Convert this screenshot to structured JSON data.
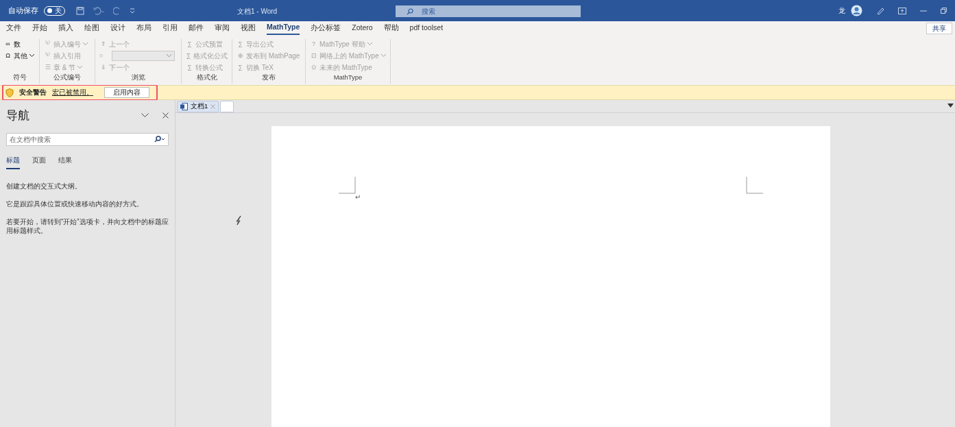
{
  "title_bar": {
    "autosave_label": "自动保存",
    "autosave": {
      "label": "关",
      "on": false
    },
    "title": "文档1  -  Word",
    "search_placeholder": "搜索",
    "user": "龙"
  },
  "ribbon_tabs": [
    {
      "label": "文件",
      "selected": false
    },
    {
      "label": "开始",
      "selected": false
    },
    {
      "label": "插入",
      "selected": false
    },
    {
      "label": "绘图",
      "selected": false
    },
    {
      "label": "设计",
      "selected": false
    },
    {
      "label": "布局",
      "selected": false
    },
    {
      "label": "引用",
      "selected": false
    },
    {
      "label": "邮件",
      "selected": false
    },
    {
      "label": "审阅",
      "selected": false
    },
    {
      "label": "视图",
      "selected": false
    },
    {
      "label": "MathType",
      "selected": true
    },
    {
      "label": "办公标签",
      "selected": false
    },
    {
      "label": "Zotero",
      "selected": false
    },
    {
      "label": "帮助",
      "selected": false
    },
    {
      "label": "pdf toolset",
      "selected": false
    }
  ],
  "share_button": "共享",
  "ribbon_groups": [
    {
      "label": "符号",
      "items": [
        {
          "kind": "button",
          "icon": "∞",
          "text": "数",
          "disabled": false
        },
        {
          "kind": "button",
          "icon": "Ω",
          "text": "其他",
          "dropdown": true,
          "disabled": false
        }
      ]
    },
    {
      "label": "公式编号",
      "items": [
        {
          "kind": "button",
          "icon": "⁽¹⁾",
          "text": "插入编号",
          "dropdown": true,
          "disabled": true
        },
        {
          "kind": "button",
          "icon": "⁽¹⁾",
          "text": "插入引用",
          "disabled": true
        },
        {
          "kind": "button",
          "icon": "☰",
          "text": "章 & 节",
          "dropdown": true,
          "disabled": true
        }
      ]
    },
    {
      "label": "浏览",
      "items": [
        {
          "kind": "button",
          "icon": "⇑",
          "text": "上一个",
          "disabled": true
        },
        {
          "kind": "combo",
          "icon": "○",
          "disabled": true
        },
        {
          "kind": "button",
          "icon": "⇓",
          "text": "下一个",
          "disabled": true
        }
      ]
    },
    {
      "label": "格式化",
      "items": [
        {
          "kind": "button",
          "icon": "∑",
          "text": "公式预置",
          "disabled": true
        },
        {
          "kind": "button",
          "icon": "∑",
          "text": "格式化公式",
          "disabled": true
        },
        {
          "kind": "button",
          "icon": "∑",
          "text": "转换公式",
          "disabled": true
        }
      ]
    },
    {
      "label": "发布",
      "items": [
        {
          "kind": "button",
          "icon": "∑",
          "text": "导出公式",
          "disabled": true
        },
        {
          "kind": "button",
          "icon": "⊕",
          "text": "发布到 MathPage",
          "disabled": true
        },
        {
          "kind": "button",
          "icon": "∑",
          "text": "切换 TeX",
          "disabled": true
        }
      ]
    },
    {
      "label": "MathType",
      "items": [
        {
          "kind": "button",
          "icon": "?",
          "text": "MathType 帮助",
          "dropdown": true,
          "disabled": true
        },
        {
          "kind": "button",
          "icon": "⊡",
          "text": "网络上的 MathType",
          "dropdown": true,
          "disabled": true
        },
        {
          "kind": "button",
          "icon": "⊙",
          "text": "未来的 MathType",
          "disabled": true
        }
      ]
    }
  ],
  "security_bar": {
    "title": "安全警告",
    "message": "宏已被禁用。",
    "button": "启用内容",
    "highlighted": true
  },
  "navigation": {
    "title": "导航",
    "search_placeholder": "在文档中搜索",
    "tabs": [
      {
        "label": "标题",
        "selected": true
      },
      {
        "label": "页面",
        "selected": false
      },
      {
        "label": "结果",
        "selected": false
      }
    ],
    "paragraphs": [
      "创建文档的交互式大纲。",
      "它是跟踪具体位置或快速移动内容的好方式。",
      "若要开始，请转到“开始”选项卡，并向文档中的标题应用标题样式。"
    ]
  },
  "document_tabs": [
    {
      "label": "文档1",
      "selected": true
    }
  ],
  "document": {
    "paragraph_mark": "↵"
  }
}
